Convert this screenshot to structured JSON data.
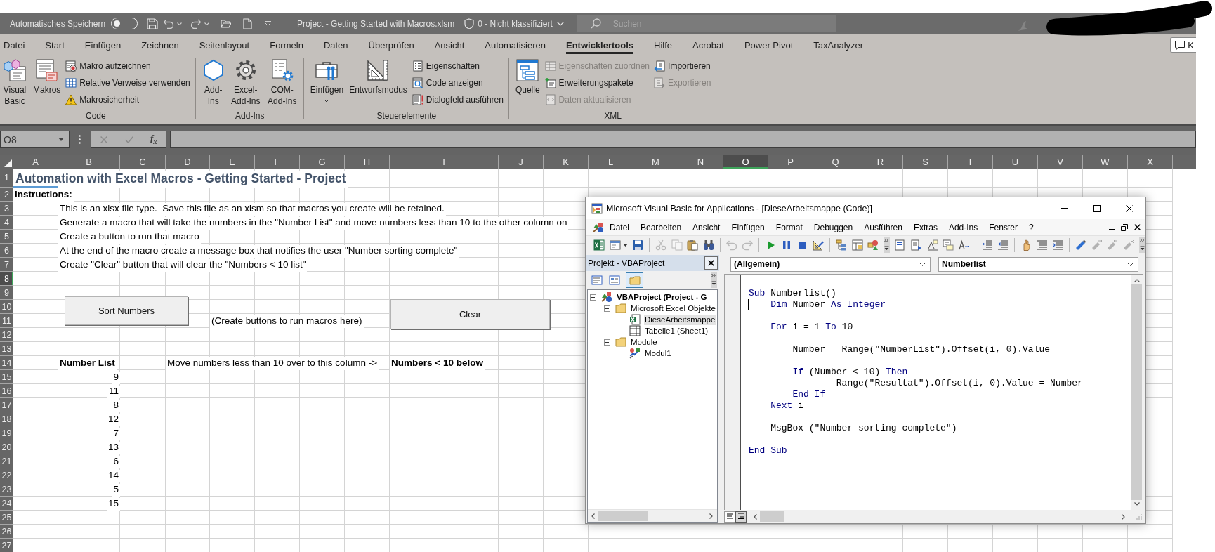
{
  "title_bar": {
    "autosave_label": "Automatisches Speichern",
    "autosave_on": false,
    "file_title": "Project - Getting Started with Macros.xlsm",
    "sensitivity": "0 - Nicht klassifiziert",
    "search": {
      "placeholder": "Suchen"
    }
  },
  "ribbon": {
    "tabs": [
      {
        "label": "Datei",
        "selected": false
      },
      {
        "label": "Start",
        "selected": false
      },
      {
        "label": "Einfügen",
        "selected": false
      },
      {
        "label": "Zeichnen",
        "selected": false
      },
      {
        "label": "Seitenlayout",
        "selected": false
      },
      {
        "label": "Formeln",
        "selected": false
      },
      {
        "label": "Daten",
        "selected": false
      },
      {
        "label": "Überprüfen",
        "selected": false
      },
      {
        "label": "Ansicht",
        "selected": false
      },
      {
        "label": "Automatisieren",
        "selected": false
      },
      {
        "label": "Entwicklertools",
        "selected": true
      },
      {
        "label": "Hilfe",
        "selected": false
      },
      {
        "label": "Acrobat",
        "selected": false
      },
      {
        "label": "Power Pivot",
        "selected": false
      },
      {
        "label": "TaxAnalyzer",
        "selected": false
      }
    ],
    "comments_button": {
      "label": "K"
    },
    "groups": [
      {
        "label": "Code",
        "items": [
          {
            "kind": "large",
            "label": "Visual Basic",
            "dropdown": false
          },
          {
            "kind": "large",
            "label": "Makros",
            "dropdown": false
          },
          {
            "kind": "small",
            "label": "Makro aufzeichnen",
            "disabled": false
          },
          {
            "kind": "small",
            "label": "Relative Verweise verwenden",
            "disabled": false
          },
          {
            "kind": "small",
            "label": "Makrosicherheit",
            "disabled": false
          }
        ]
      },
      {
        "label": "Add-Ins",
        "items": [
          {
            "kind": "large",
            "label": "Add-Ins",
            "dropdown": false
          },
          {
            "kind": "large",
            "label": "Excel-Add-Ins",
            "dropdown": false
          },
          {
            "kind": "large",
            "label": "COM-Add-Ins",
            "dropdown": false
          }
        ]
      },
      {
        "label": "Steuerelemente",
        "items": [
          {
            "kind": "large",
            "label": "Einfügen",
            "dropdown": true
          },
          {
            "kind": "large",
            "label": "Entwurfsmodus",
            "dropdown": false
          },
          {
            "kind": "small",
            "label": "Eigenschaften",
            "disabled": false
          },
          {
            "kind": "small",
            "label": "Code anzeigen",
            "disabled": false
          },
          {
            "kind": "small",
            "label": "Dialogfeld ausführen",
            "disabled": false
          }
        ]
      },
      {
        "label": "XML",
        "items": [
          {
            "kind": "large",
            "label": "Quelle",
            "dropdown": false
          },
          {
            "kind": "small",
            "label": "Eigenschaften zuordnen",
            "disabled": true
          },
          {
            "kind": "small",
            "label": "Erweiterungspakete",
            "disabled": false
          },
          {
            "kind": "small",
            "label": "Daten aktualisieren",
            "disabled": true
          },
          {
            "kind": "small",
            "label": "Importieren",
            "disabled": false
          },
          {
            "kind": "small",
            "label": "Exportieren",
            "disabled": true
          }
        ]
      }
    ]
  },
  "formula_bar": {
    "name_box": "O8",
    "function_button": "f$_{x}$"
  },
  "sheet": {
    "columns": [
      {
        "label": "A",
        "selected": false
      },
      {
        "label": "B",
        "selected": false
      },
      {
        "label": "C",
        "selected": false
      },
      {
        "label": "D",
        "selected": false
      },
      {
        "label": "E",
        "selected": false
      },
      {
        "label": "F",
        "selected": false
      },
      {
        "label": "G",
        "selected": false
      },
      {
        "label": "H",
        "selected": false
      },
      {
        "label": "I",
        "selected": false
      },
      {
        "label": "J",
        "selected": false
      },
      {
        "label": "K",
        "selected": false
      },
      {
        "label": "L",
        "selected": false
      },
      {
        "label": "M",
        "selected": false
      },
      {
        "label": "N",
        "selected": false
      },
      {
        "label": "O",
        "selected": true
      },
      {
        "label": "P",
        "selected": false
      },
      {
        "label": "Q",
        "selected": false
      },
      {
        "label": "R",
        "selected": false
      },
      {
        "label": "S",
        "selected": false
      },
      {
        "label": "T",
        "selected": false
      },
      {
        "label": "U",
        "selected": false
      },
      {
        "label": "V",
        "selected": false
      },
      {
        "label": "W",
        "selected": false
      },
      {
        "label": "X",
        "selected": false
      }
    ],
    "rows": [
      {
        "header": "1",
        "selected": false,
        "cells": [
          {
            "kind": "title",
            "text": "Automation with Excel Macros - Getting Started - Project"
          }
        ]
      },
      {
        "header": "2",
        "selected": false,
        "cells": [
          {
            "kind": "bold",
            "text": "Instructions:"
          }
        ]
      },
      {
        "header": "3",
        "selected": false,
        "cells": [
          {
            "kind": "empty"
          },
          {
            "kind": "text",
            "text": "This is an xlsx file type.  Save this file as an xlsm so that macros you create will be retained."
          }
        ]
      },
      {
        "header": "4",
        "selected": false,
        "cells": [
          {
            "kind": "empty"
          },
          {
            "kind": "text",
            "text": "Generate a macro that will take the numbers in the \"Number List\" and move numbers less than 10 to the other column on"
          }
        ]
      },
      {
        "header": "5",
        "selected": false,
        "cells": [
          {
            "kind": "empty"
          },
          {
            "kind": "text",
            "text": "Create a button to run that macro"
          }
        ]
      },
      {
        "header": "6",
        "selected": false,
        "cells": [
          {
            "kind": "empty"
          },
          {
            "kind": "text",
            "text": "At the end of the macro create a message box that notifies the user \"Number sorting complete\""
          }
        ]
      },
      {
        "header": "7",
        "selected": false,
        "cells": [
          {
            "kind": "empty"
          },
          {
            "kind": "text",
            "text": "Create \"Clear\" button that will clear the \"Numbers < 10 list\""
          }
        ]
      },
      {
        "header": "8",
        "selected": true
      },
      {
        "header": "9",
        "selected": false
      },
      {
        "header": "10",
        "selected": false
      },
      {
        "header": "11",
        "selected": false,
        "cells": [
          {
            "kind": "empty"
          },
          {
            "kind": "empty"
          },
          {
            "kind": "empty"
          },
          {
            "kind": "empty"
          },
          {
            "kind": "text",
            "text": "(Create buttons to run macros here)"
          }
        ]
      },
      {
        "header": "12",
        "selected": false
      },
      {
        "header": "13",
        "selected": false
      },
      {
        "header": "14",
        "selected": false,
        "cells": [
          {
            "kind": "empty"
          },
          {
            "kind": "heading",
            "text": "Number List"
          },
          {
            "kind": "empty"
          },
          {
            "kind": "text",
            "text": "Move numbers less than 10 over to this column ->"
          },
          {
            "kind": "empty"
          },
          {
            "kind": "empty"
          },
          {
            "kind": "empty"
          },
          {
            "kind": "empty"
          },
          {
            "kind": "heading",
            "text": "Numbers < 10 below"
          }
        ]
      },
      {
        "header": "15",
        "selected": false,
        "cells": [
          {
            "kind": "empty"
          },
          {
            "kind": "number",
            "text": "9"
          }
        ]
      },
      {
        "header": "16",
        "selected": false,
        "cells": [
          {
            "kind": "empty"
          },
          {
            "kind": "number",
            "text": "11"
          }
        ]
      },
      {
        "header": "17",
        "selected": false,
        "cells": [
          {
            "kind": "empty"
          },
          {
            "kind": "number",
            "text": "8"
          }
        ]
      },
      {
        "header": "18",
        "selected": false,
        "cells": [
          {
            "kind": "empty"
          },
          {
            "kind": "number",
            "text": "12"
          }
        ]
      },
      {
        "header": "19",
        "selected": false,
        "cells": [
          {
            "kind": "empty"
          },
          {
            "kind": "number",
            "text": "7"
          }
        ]
      },
      {
        "header": "20",
        "selected": false,
        "cells": [
          {
            "kind": "empty"
          },
          {
            "kind": "number",
            "text": "13"
          }
        ]
      },
      {
        "header": "21",
        "selected": false,
        "cells": [
          {
            "kind": "empty"
          },
          {
            "kind": "number",
            "text": "6"
          }
        ]
      },
      {
        "header": "22",
        "selected": false,
        "cells": [
          {
            "kind": "empty"
          },
          {
            "kind": "number",
            "text": "14"
          }
        ]
      },
      {
        "header": "23",
        "selected": false,
        "cells": [
          {
            "kind": "empty"
          },
          {
            "kind": "number",
            "text": "5"
          }
        ]
      },
      {
        "header": "24",
        "selected": false,
        "cells": [
          {
            "kind": "empty"
          },
          {
            "kind": "number",
            "text": "15"
          }
        ]
      },
      {
        "header": "25",
        "selected": false
      },
      {
        "header": "26",
        "selected": false
      },
      {
        "header": "27",
        "selected": false
      }
    ],
    "buttons": [
      {
        "label": "Sort Numbers"
      },
      {
        "label": "Clear"
      }
    ]
  },
  "vba_window": {
    "title": "Microsoft Visual Basic for Applications - [DieseArbeitsmappe (Code)]",
    "menu": [
      {
        "label": "Datei"
      },
      {
        "label": "Bearbeiten"
      },
      {
        "label": "Ansicht"
      },
      {
        "label": "Einfügen"
      },
      {
        "label": "Format"
      },
      {
        "label": "Debuggen"
      },
      {
        "label": "Ausführen"
      },
      {
        "label": "Extras"
      },
      {
        "label": "Add-Ins"
      },
      {
        "label": "Fenster"
      },
      {
        "label": "?"
      }
    ],
    "toolbar": [
      {
        "kind": "button",
        "disabled": false
      },
      {
        "kind": "dropdown",
        "disabled": false
      },
      {
        "kind": "button",
        "disabled": false
      },
      {
        "kind": "separator"
      },
      {
        "kind": "button",
        "disabled": true
      },
      {
        "kind": "button",
        "disabled": true
      },
      {
        "kind": "button",
        "disabled": false
      },
      {
        "kind": "button",
        "disabled": false
      },
      {
        "kind": "separator"
      },
      {
        "kind": "button",
        "disabled": true
      },
      {
        "kind": "button",
        "disabled": true
      },
      {
        "kind": "separator"
      },
      {
        "kind": "button",
        "disabled": false
      },
      {
        "kind": "button",
        "disabled": false
      },
      {
        "kind": "button",
        "disabled": false
      },
      {
        "kind": "button",
        "disabled": false
      },
      {
        "kind": "separator"
      },
      {
        "kind": "button",
        "disabled": false
      },
      {
        "kind": "button",
        "disabled": false
      },
      {
        "kind": "button",
        "disabled": false
      },
      {
        "kind": "handle"
      },
      {
        "kind": "button",
        "disabled": false
      },
      {
        "kind": "button",
        "disabled": false
      },
      {
        "kind": "button",
        "disabled": false
      },
      {
        "kind": "button",
        "disabled": false
      },
      {
        "kind": "button",
        "disabled": false
      },
      {
        "kind": "separator"
      },
      {
        "kind": "button",
        "disabled": false
      },
      {
        "kind": "button",
        "disabled": false
      },
      {
        "kind": "separator"
      },
      {
        "kind": "button",
        "disabled": false
      },
      {
        "kind": "button",
        "disabled": false
      },
      {
        "kind": "button",
        "disabled": false
      },
      {
        "kind": "separator"
      },
      {
        "kind": "button",
        "disabled": false
      },
      {
        "kind": "button",
        "disabled": true
      },
      {
        "kind": "button",
        "disabled": true
      },
      {
        "kind": "button",
        "disabled": true
      },
      {
        "kind": "handle"
      }
    ],
    "project_pane": {
      "title": "Projekt - VBAProject",
      "tools": [
        {
          "selected": false
        },
        {
          "selected": false
        },
        {
          "selected": true
        }
      ],
      "tree": [
        {
          "kind": "project",
          "label": "VBAProject (Project - G",
          "expanded": true,
          "selected": false,
          "children": [
            {
              "kind": "folder",
              "label": "Microsoft Excel Objekte",
              "expanded": true,
              "selected": false,
              "children": [
                {
                  "kind": "workbook",
                  "label": "DieseArbeitsmappe",
                  "selected": true
                },
                {
                  "kind": "sheet",
                  "label": "Tabelle1 (Sheet1)",
                  "selected": false
                }
              ]
            },
            {
              "kind": "folder",
              "label": "Module",
              "expanded": true,
              "selected": false,
              "children": [
                {
                  "kind": "module",
                  "label": "Modul1",
                  "selected": false
                }
              ]
            }
          ]
        }
      ]
    },
    "code_pane": {
      "object": "(Allgemein)",
      "procedure": "Numberlist",
      "views": [
        {
          "selected": false
        },
        {
          "selected": true
        }
      ],
      "lines": [
        {
          "kind": "code",
          "cursor": false,
          "tokens": [
            {
              "kind": "keyword",
              "text": "Sub"
            },
            {
              "kind": "plain",
              "text": " Numberlist()"
            }
          ]
        },
        {
          "kind": "code",
          "cursor": true,
          "tokens": [
            {
              "kind": "keyword",
              "text": "    Dim"
            },
            {
              "kind": "plain",
              "text": " Number "
            },
            {
              "kind": "keyword",
              "text": "As Integer"
            }
          ]
        },
        {
          "kind": "blank"
        },
        {
          "kind": "code",
          "cursor": false,
          "tokens": [
            {
              "kind": "keyword",
              "text": "    For"
            },
            {
              "kind": "plain",
              "text": " i = 1 "
            },
            {
              "kind": "keyword",
              "text": "To"
            },
            {
              "kind": "plain",
              "text": " 10"
            }
          ]
        },
        {
          "kind": "blank"
        },
        {
          "kind": "code",
          "cursor": false,
          "tokens": [
            {
              "kind": "plain",
              "text": "        Number = Range(\"NumberList\").Offset(i, 0).Value"
            }
          ]
        },
        {
          "kind": "blank"
        },
        {
          "kind": "code",
          "cursor": false,
          "tokens": [
            {
              "kind": "keyword",
              "text": "        If"
            },
            {
              "kind": "plain",
              "text": " (Number < 10) "
            },
            {
              "kind": "keyword",
              "text": "Then"
            }
          ]
        },
        {
          "kind": "code",
          "cursor": false,
          "tokens": [
            {
              "kind": "plain",
              "text": "                Range(\"Resultat\").Offset(i, 0).Value = Number"
            }
          ]
        },
        {
          "kind": "code",
          "cursor": false,
          "tokens": [
            {
              "kind": "keyword",
              "text": "        End If"
            }
          ]
        },
        {
          "kind": "code",
          "cursor": false,
          "tokens": [
            {
              "kind": "keyword",
              "text": "    Next"
            },
            {
              "kind": "plain",
              "text": " i"
            }
          ]
        },
        {
          "kind": "blank"
        },
        {
          "kind": "code",
          "cursor": false,
          "tokens": [
            {
              "kind": "plain",
              "text": "    MsgBox (\"Number sorting complete\")"
            }
          ]
        },
        {
          "kind": "blank"
        },
        {
          "kind": "code",
          "cursor": false,
          "tokens": [
            {
              "kind": "keyword",
              "text": "End Sub"
            }
          ]
        }
      ]
    }
  }
}
